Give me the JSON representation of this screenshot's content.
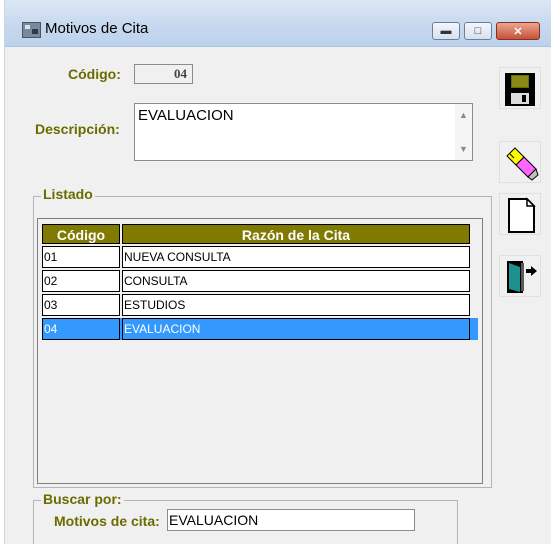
{
  "window": {
    "title": "Motivos de Cita"
  },
  "form": {
    "codigo_label": "Código:",
    "codigo_value": "04",
    "descripcion_label": "Descripción:",
    "descripcion_value": "EVALUACION"
  },
  "listado": {
    "legend": "Listado",
    "columns": [
      "Código",
      "Razón de la Cita"
    ],
    "rows": [
      {
        "codigo": "01",
        "razon": "NUEVA CONSULTA",
        "selected": false
      },
      {
        "codigo": "02",
        "razon": "CONSULTA",
        "selected": false
      },
      {
        "codigo": "03",
        "razon": "ESTUDIOS",
        "selected": false
      },
      {
        "codigo": "04",
        "razon": "EVALUACION",
        "selected": true
      }
    ]
  },
  "buscar": {
    "legend": "Buscar por:",
    "field_label": "Motivos de cita:",
    "field_value": "EVALUACION"
  },
  "toolbar": {
    "icons": [
      "save-disk-icon",
      "eraser-icon",
      "new-document-icon",
      "exit-door-icon"
    ]
  },
  "colors": {
    "label": "#6b6b00",
    "header_bg": "#807a00",
    "selection": "#3399ff"
  }
}
